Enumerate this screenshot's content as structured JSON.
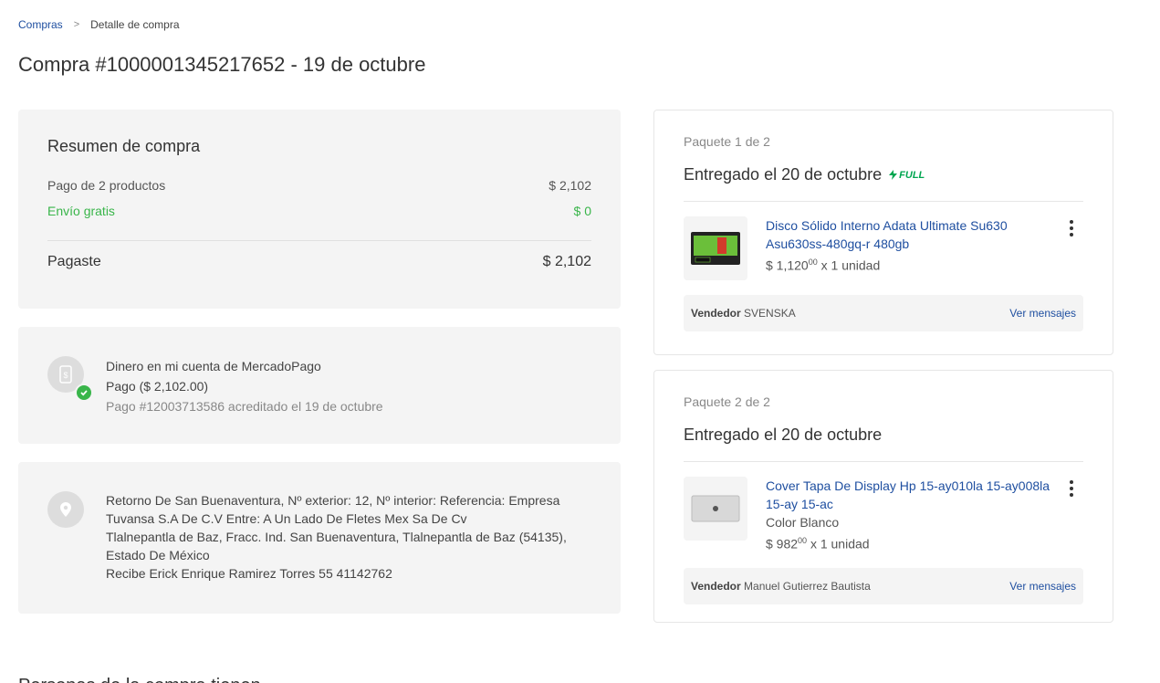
{
  "breadcrumb": {
    "root": "Compras",
    "separator": ">",
    "current": "Detalle de compra"
  },
  "page_title": "Compra #1000001345217652 - 19 de octubre",
  "summary": {
    "title": "Resumen de compra",
    "products_label": "Pago de 2 productos",
    "products_value": "$ 2,102",
    "shipping_label": "Envío gratis",
    "shipping_value": "$ 0",
    "total_label": "Pagaste",
    "total_value": "$ 2,102"
  },
  "payment": {
    "method": "Dinero en mi cuenta de MercadoPago",
    "amount": "Pago ($ 2,102.00)",
    "detail": "Pago #12003713586 acreditado el 19 de octubre"
  },
  "address": {
    "line1": "Retorno De San Buenaventura, Nº exterior: 12, Nº interior: Referencia: Empresa",
    "line2": "Tuvansa S.A De C.V Entre: A Un Lado De Fletes Mex Sa De Cv",
    "line3": "Tlalnepantla de Baz, Fracc. Ind. San Buenaventura, Tlalnepantla de Baz (54135),",
    "line4": "Estado De México",
    "line5": "Recibe Erick Enrique Ramirez Torres 55 41142762"
  },
  "packages": [
    {
      "label": "Paquete 1 de 2",
      "status": "Entregado el 20 de octubre",
      "badge": "FULL",
      "item_title_1": "Disco Sólido Interno Adata Ultimate Su630",
      "item_title_2": "Asu630ss-480gq-r 480gb",
      "price_main": "$ 1,120",
      "price_cents": "00",
      "qty": "x 1 unidad",
      "seller_label": "Vendedor",
      "seller_name": "SVENSKA",
      "messages": "Ver mensajes"
    },
    {
      "label": "Paquete 2 de 2",
      "status": "Entregado el 20 de octubre",
      "item_title_1": "Cover Tapa De Display Hp 15-ay010la 15-ay008la",
      "item_title_2": "15-ay 15-ac",
      "variant": "Color Blanco",
      "price_main": "$ 982",
      "price_cents": "00",
      "qty": "x 1 unidad",
      "seller_label": "Vendedor",
      "seller_name": "Manuel Gutierrez Bautista",
      "messages": "Ver mensajes"
    }
  ],
  "bottom_heading": "Personas de la compra tienen",
  "colors": {
    "link": "#1f4fa0",
    "green": "#39b54a",
    "full": "#00a650",
    "card_bg": "#f4f4f4"
  }
}
